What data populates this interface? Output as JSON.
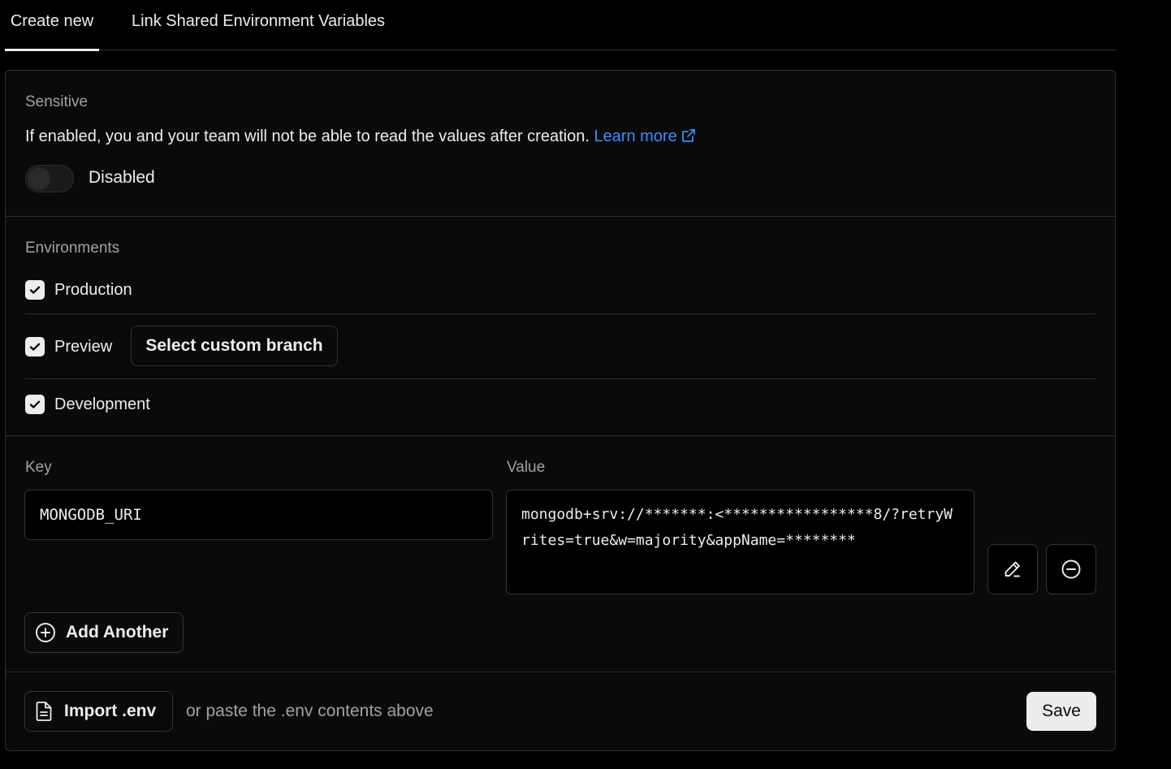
{
  "tabs": [
    {
      "label": "Create new",
      "active": true
    },
    {
      "label": "Link Shared Environment Variables",
      "active": false
    }
  ],
  "sensitive": {
    "label": "Sensitive",
    "description": "If enabled, you and your team will not be able to read the values after creation.",
    "learn_more": "Learn more",
    "toggle_state": "Disabled",
    "enabled": false
  },
  "environments": {
    "label": "Environments",
    "items": [
      {
        "label": "Production",
        "checked": true
      },
      {
        "label": "Preview",
        "checked": true
      },
      {
        "label": "Development",
        "checked": true
      }
    ],
    "select_branch_label": "Select custom branch"
  },
  "variable": {
    "key_label": "Key",
    "value_label": "Value",
    "key": "MONGODB_URI",
    "value": "mongodb+srv://*******:<*****************8/?retryWrites=true&w=majority&appName=********"
  },
  "add_another_label": "Add Another",
  "footer": {
    "import_label": "Import .env",
    "paste_hint": "or paste the .env contents above",
    "save_label": "Save"
  },
  "colors": {
    "background": "#000000",
    "card": "#0a0a0a",
    "border": "#2e2e2e",
    "link": "#3291ff",
    "text": "#ededed",
    "muted": "#a1a1a1"
  }
}
